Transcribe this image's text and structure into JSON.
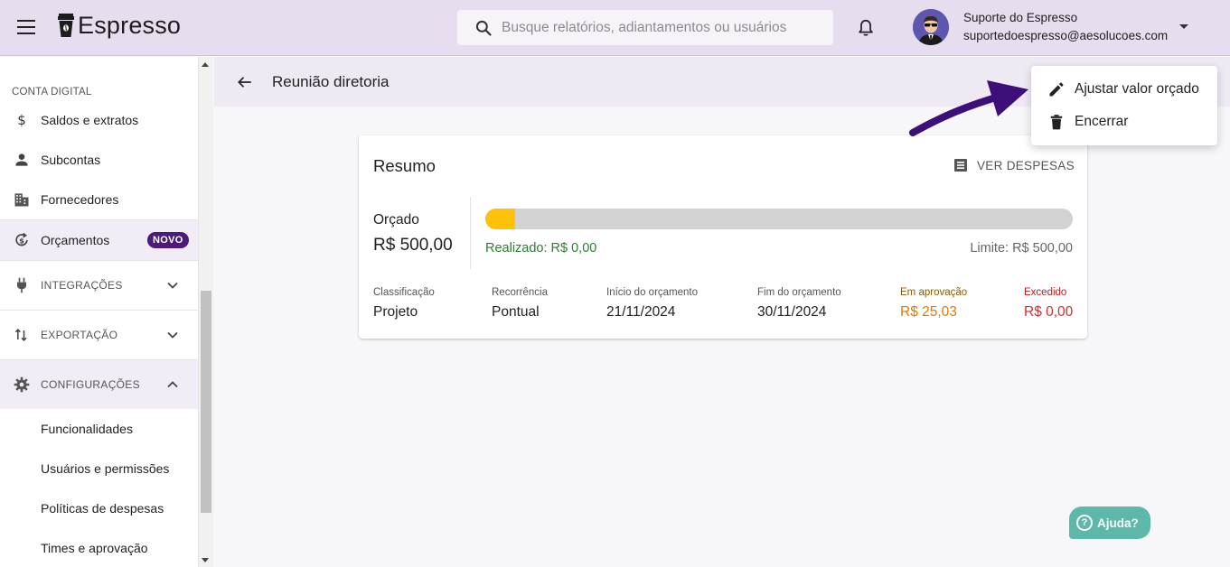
{
  "app": {
    "name": "Espresso"
  },
  "search": {
    "placeholder": "Busque relatórios, adiantamentos ou usuários"
  },
  "user": {
    "name": "Suporte do Espresso",
    "email": "suportedoespresso@aesolucoes.com"
  },
  "sidebar": {
    "section_label": "CONTA DIGITAL",
    "items": [
      {
        "label": "Saldos e extratos",
        "icon": "dollar-icon"
      },
      {
        "label": "Subcontas",
        "icon": "person-icon"
      },
      {
        "label": "Fornecedores",
        "icon": "building-icon"
      },
      {
        "label": "Orçamentos",
        "icon": "budget-icon",
        "badge": "NOVO"
      }
    ],
    "groups": [
      {
        "label": "INTEGRAÇÕES",
        "icon": "plug-icon",
        "expanded": false
      },
      {
        "label": "EXPORTAÇÃO",
        "icon": "swap-vert-icon",
        "expanded": false
      },
      {
        "label": "CONFIGURAÇÕES",
        "icon": "gear-icon",
        "expanded": true
      }
    ],
    "sub_items": [
      "Funcionalidades",
      "Usuários e permissões",
      "Políticas de despesas",
      "Times e aprovação"
    ]
  },
  "page": {
    "title": "Reunião diretoria"
  },
  "summary": {
    "title": "Resumo",
    "ver_despesas": "VER DESPESAS",
    "orcado_label": "Orçado",
    "orcado_value": "R$ 500,00",
    "progress_fraction": 0.05,
    "realizado": "Realizado: R$ 0,00",
    "limite": "Limite: R$ 500,00",
    "fields": [
      {
        "label": "Classificação",
        "value": "Projeto"
      },
      {
        "label": "Recorrência",
        "value": "Pontual"
      },
      {
        "label": "Início do orçamento",
        "value": "21/11/2024"
      },
      {
        "label": "Fim do orçamento",
        "value": "30/11/2024"
      },
      {
        "label": "Em aprovação",
        "value": "R$ 25,03"
      },
      {
        "label": "Excedido",
        "value": "R$ 0,00"
      }
    ]
  },
  "menu": {
    "items": [
      {
        "label": "Ajustar valor orçado",
        "icon": "pencil-icon"
      },
      {
        "label": "Encerrar",
        "icon": "trash-icon"
      }
    ]
  },
  "help": {
    "label": "Ajuda?"
  },
  "colors": {
    "accent": "#4b1a7a",
    "appbar": "#e6ddee",
    "progress": "#ffc107",
    "realized": "#2e7d32",
    "pending": "#e07b00",
    "exceeded": "#d32f2f",
    "help": "#5db8a9",
    "annotation_arrow": "#3d0f78"
  }
}
